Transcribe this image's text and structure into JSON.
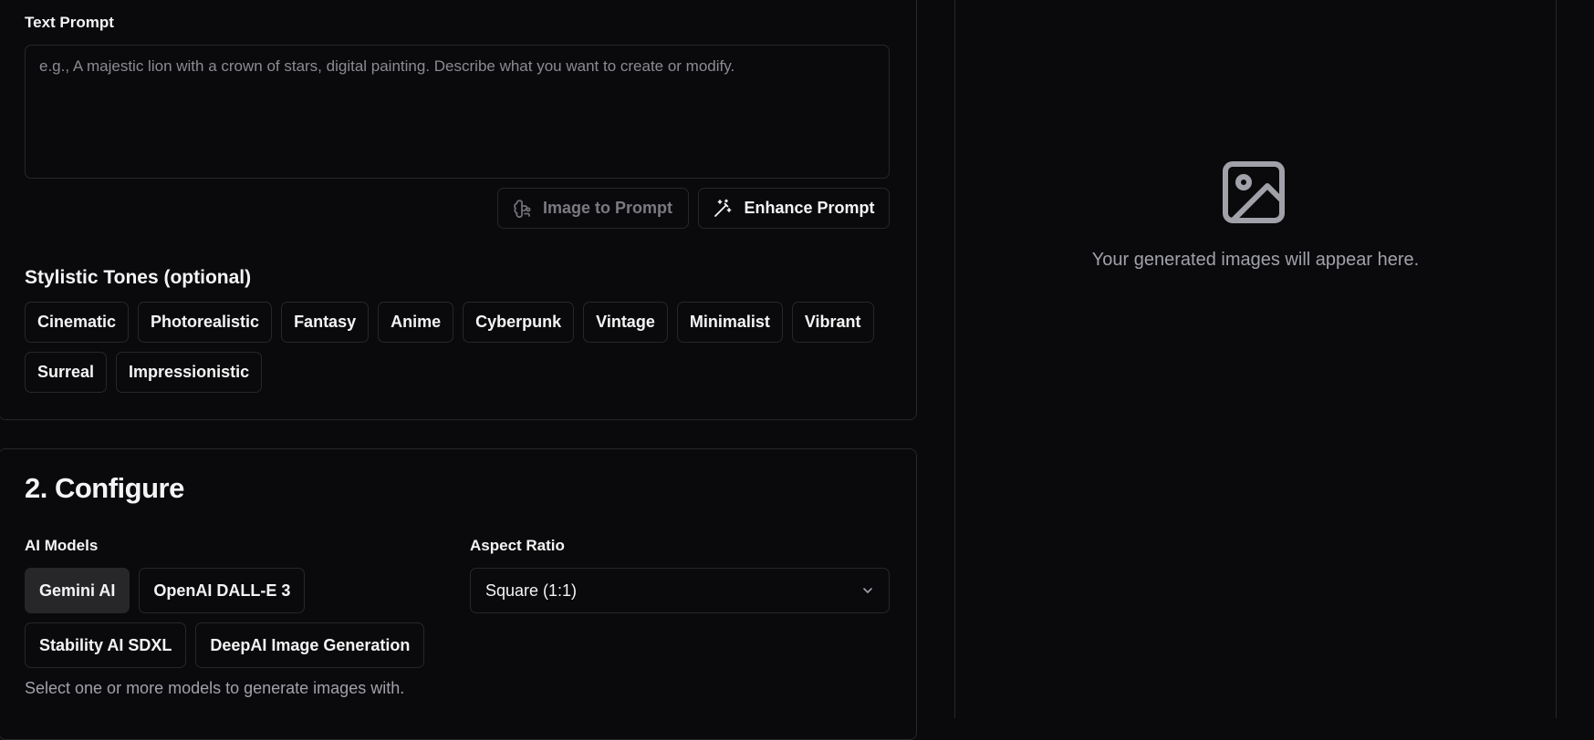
{
  "prompt": {
    "label": "Text Prompt",
    "placeholder": "e.g., A majestic lion with a crown of stars, digital painting. Describe what you want to create or modify.",
    "value": "",
    "image_to_prompt_label": "Image to Prompt",
    "enhance_prompt_label": "Enhance Prompt"
  },
  "tones": {
    "title": "Stylistic Tones (optional)",
    "row1": [
      "Cinematic",
      "Photorealistic",
      "Fantasy",
      "Anime",
      "Cyberpunk",
      "Vintage",
      "Minimalist",
      "Vibrant"
    ],
    "row2": [
      "Surreal",
      "Impressionistic"
    ]
  },
  "configure": {
    "title": "2. Configure",
    "models_label": "AI Models",
    "models_row1": [
      "Gemini AI",
      "OpenAI DALL-E 3"
    ],
    "models_row2": [
      "Stability AI SDXL",
      "DeepAI Image Generation"
    ],
    "selected_model": "Gemini AI",
    "models_hint": "Select one or more models to generate images with.",
    "aspect_label": "Aspect Ratio",
    "aspect_value": "Square (1:1)"
  },
  "preview": {
    "empty_text": "Your generated images will appear here.",
    "icon": "image-icon"
  },
  "colors": {
    "background": "#0a0a0c",
    "border": "#27272a",
    "active_chip": "#27272a",
    "muted_text": "#a1a1aa"
  }
}
